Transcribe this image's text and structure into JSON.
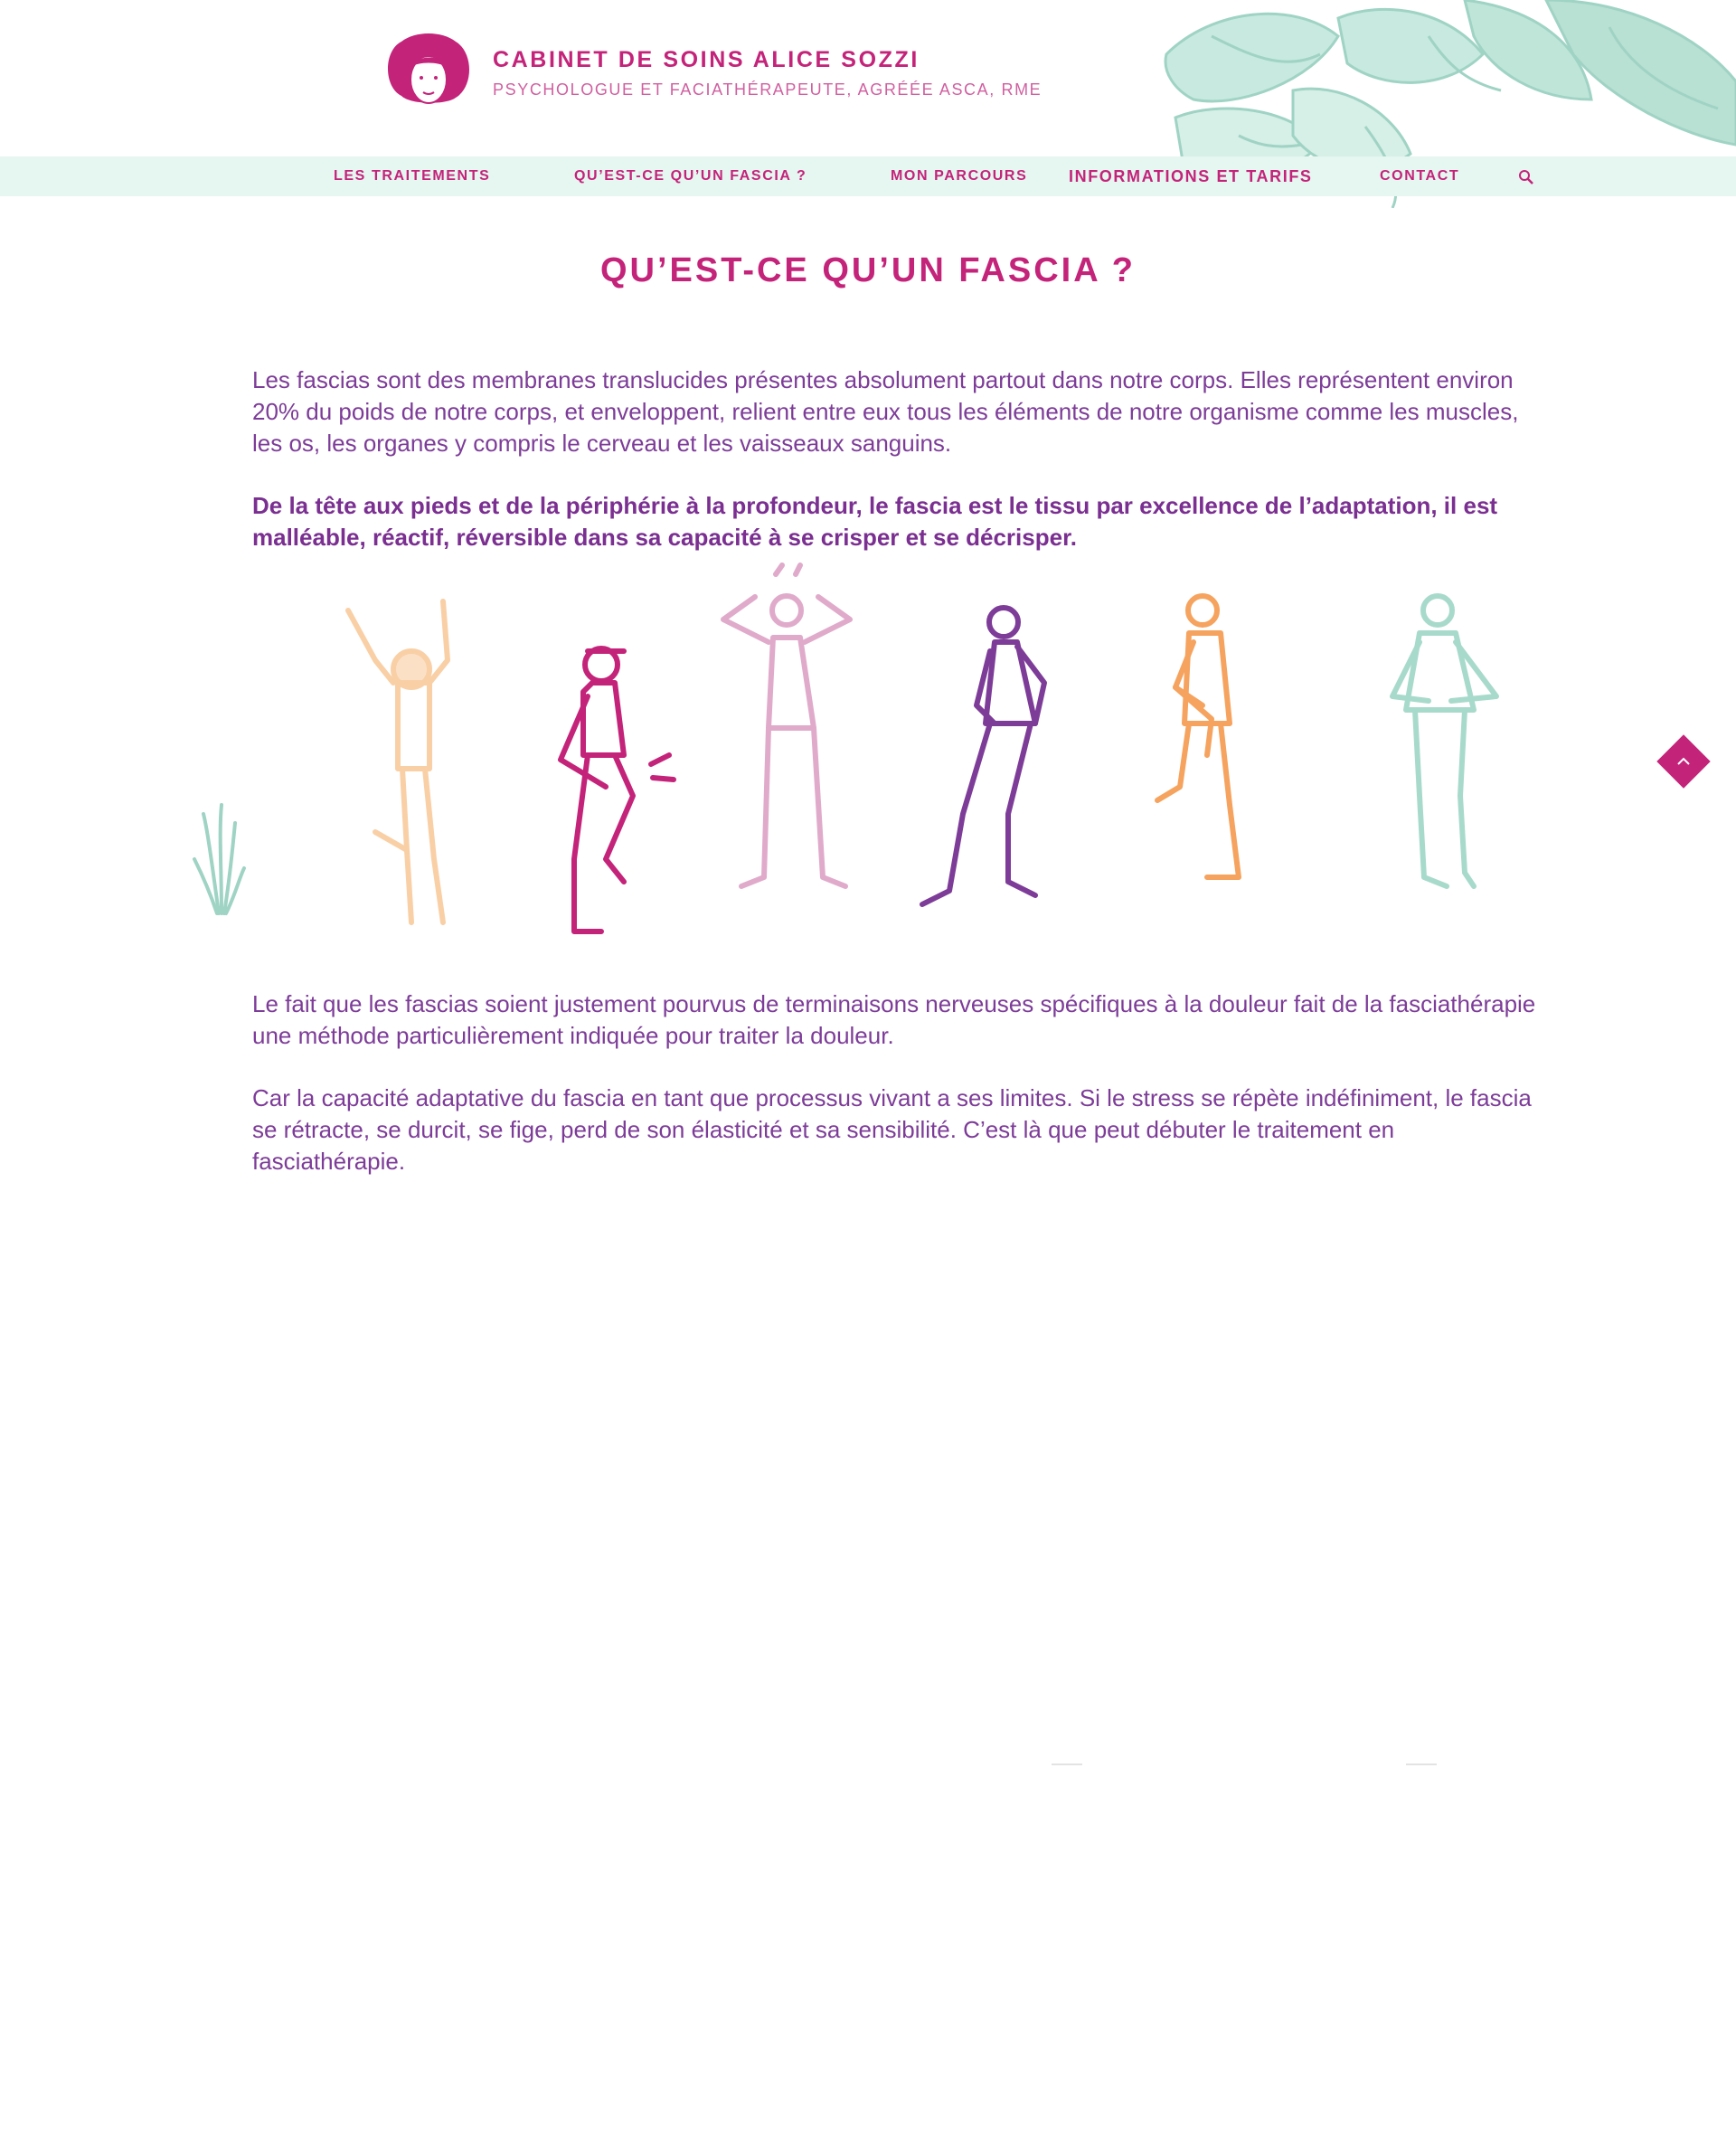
{
  "site": {
    "title": "CABINET DE SOINS ALICE SOZZI",
    "subtitle": "PSYCHOLOGUE ET FACIATHÉRAPEUTE, AGRÉÉE ASCA, RME"
  },
  "nav": {
    "items": [
      {
        "label": "LES TRAITEMENTS"
      },
      {
        "label": "QU’EST-CE QU’UN FASCIA ?"
      },
      {
        "label": "MON PARCOURS"
      },
      {
        "label": "INFORMATIONS ET TARIFS"
      },
      {
        "label": "CONTACT"
      }
    ],
    "search_icon": "search-icon"
  },
  "main": {
    "title": "QU’EST-CE QU’UN FASCIA ?",
    "paragraphs": [
      "Les fascias sont des membranes translucides présentes absolument partout dans notre corps. Elles représentent environ 20% du poids de notre corps, et enveloppent, relient entre eux tous les éléments de notre organisme comme les muscles, les os, les organes y compris le cerveau et les vaisseaux sanguins.",
      "De la tête aux pieds et de la périphérie à la profondeur, le fascia est le tissu par excellence de l’adaptation, il est malléable, réactif, réversible dans sa capacité à se crisper et se décrisper.",
      "Le fait que les fascias soient justement pourvus de terminaisons nerveuses spécifiques à la douleur fait de la fasciathérapie une méthode particulièrement indiquée pour traiter la douleur.",
      "Car la capacité adaptative du fascia en tant que processus vivant a ses limites. Si le stress se répète indéfiniment, le fascia se rétracte, se durcit, se fige, perd de son élasticité et sa sensibilité. C’est là que peut débuter le traitement en fasciathérapie."
    ]
  },
  "illustration": {
    "figures": [
      "peach-figure-arms-up",
      "magenta-figure-knee-pain",
      "pink-figure-hands-on-head",
      "purple-figure-back-pain",
      "orange-figure-holding-knee",
      "mint-figure-stomach-pain"
    ],
    "figure_colors": [
      "#f9cfa6",
      "#c4237a",
      "#e0aacb",
      "#7d3c98",
      "#f5a35e",
      "#a8dacb"
    ]
  },
  "colors": {
    "accent": "#c4237a",
    "text": "#7d3c98",
    "nav_bg": "#e6f6f1",
    "leaf": "#9fd3c4"
  },
  "back_to_top_icon": "chevron-up-icon"
}
